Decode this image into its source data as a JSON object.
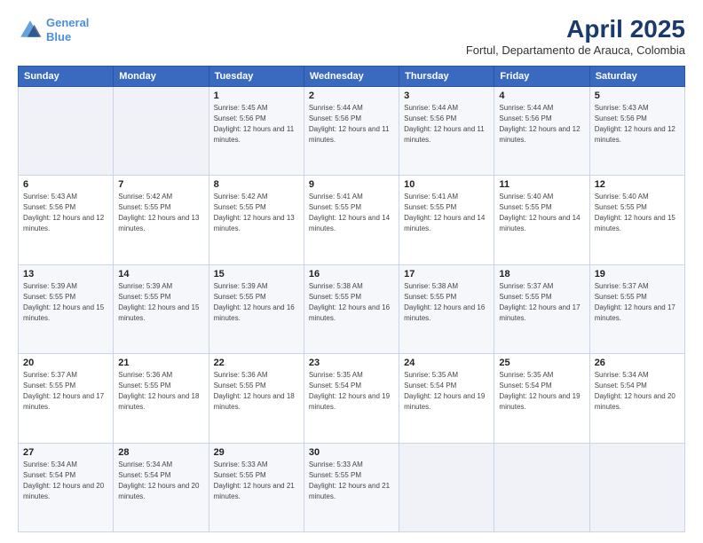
{
  "logo": {
    "line1": "General",
    "line2": "Blue"
  },
  "title": "April 2025",
  "subtitle": "Fortul, Departamento de Arauca, Colombia",
  "header": {
    "days": [
      "Sunday",
      "Monday",
      "Tuesday",
      "Wednesday",
      "Thursday",
      "Friday",
      "Saturday"
    ]
  },
  "weeks": [
    [
      {
        "day": "",
        "sunrise": "",
        "sunset": "",
        "daylight": ""
      },
      {
        "day": "",
        "sunrise": "",
        "sunset": "",
        "daylight": ""
      },
      {
        "day": "1",
        "sunrise": "Sunrise: 5:45 AM",
        "sunset": "Sunset: 5:56 PM",
        "daylight": "Daylight: 12 hours and 11 minutes."
      },
      {
        "day": "2",
        "sunrise": "Sunrise: 5:44 AM",
        "sunset": "Sunset: 5:56 PM",
        "daylight": "Daylight: 12 hours and 11 minutes."
      },
      {
        "day": "3",
        "sunrise": "Sunrise: 5:44 AM",
        "sunset": "Sunset: 5:56 PM",
        "daylight": "Daylight: 12 hours and 11 minutes."
      },
      {
        "day": "4",
        "sunrise": "Sunrise: 5:44 AM",
        "sunset": "Sunset: 5:56 PM",
        "daylight": "Daylight: 12 hours and 12 minutes."
      },
      {
        "day": "5",
        "sunrise": "Sunrise: 5:43 AM",
        "sunset": "Sunset: 5:56 PM",
        "daylight": "Daylight: 12 hours and 12 minutes."
      }
    ],
    [
      {
        "day": "6",
        "sunrise": "Sunrise: 5:43 AM",
        "sunset": "Sunset: 5:56 PM",
        "daylight": "Daylight: 12 hours and 12 minutes."
      },
      {
        "day": "7",
        "sunrise": "Sunrise: 5:42 AM",
        "sunset": "Sunset: 5:55 PM",
        "daylight": "Daylight: 12 hours and 13 minutes."
      },
      {
        "day": "8",
        "sunrise": "Sunrise: 5:42 AM",
        "sunset": "Sunset: 5:55 PM",
        "daylight": "Daylight: 12 hours and 13 minutes."
      },
      {
        "day": "9",
        "sunrise": "Sunrise: 5:41 AM",
        "sunset": "Sunset: 5:55 PM",
        "daylight": "Daylight: 12 hours and 14 minutes."
      },
      {
        "day": "10",
        "sunrise": "Sunrise: 5:41 AM",
        "sunset": "Sunset: 5:55 PM",
        "daylight": "Daylight: 12 hours and 14 minutes."
      },
      {
        "day": "11",
        "sunrise": "Sunrise: 5:40 AM",
        "sunset": "Sunset: 5:55 PM",
        "daylight": "Daylight: 12 hours and 14 minutes."
      },
      {
        "day": "12",
        "sunrise": "Sunrise: 5:40 AM",
        "sunset": "Sunset: 5:55 PM",
        "daylight": "Daylight: 12 hours and 15 minutes."
      }
    ],
    [
      {
        "day": "13",
        "sunrise": "Sunrise: 5:39 AM",
        "sunset": "Sunset: 5:55 PM",
        "daylight": "Daylight: 12 hours and 15 minutes."
      },
      {
        "day": "14",
        "sunrise": "Sunrise: 5:39 AM",
        "sunset": "Sunset: 5:55 PM",
        "daylight": "Daylight: 12 hours and 15 minutes."
      },
      {
        "day": "15",
        "sunrise": "Sunrise: 5:39 AM",
        "sunset": "Sunset: 5:55 PM",
        "daylight": "Daylight: 12 hours and 16 minutes."
      },
      {
        "day": "16",
        "sunrise": "Sunrise: 5:38 AM",
        "sunset": "Sunset: 5:55 PM",
        "daylight": "Daylight: 12 hours and 16 minutes."
      },
      {
        "day": "17",
        "sunrise": "Sunrise: 5:38 AM",
        "sunset": "Sunset: 5:55 PM",
        "daylight": "Daylight: 12 hours and 16 minutes."
      },
      {
        "day": "18",
        "sunrise": "Sunrise: 5:37 AM",
        "sunset": "Sunset: 5:55 PM",
        "daylight": "Daylight: 12 hours and 17 minutes."
      },
      {
        "day": "19",
        "sunrise": "Sunrise: 5:37 AM",
        "sunset": "Sunset: 5:55 PM",
        "daylight": "Daylight: 12 hours and 17 minutes."
      }
    ],
    [
      {
        "day": "20",
        "sunrise": "Sunrise: 5:37 AM",
        "sunset": "Sunset: 5:55 PM",
        "daylight": "Daylight: 12 hours and 17 minutes."
      },
      {
        "day": "21",
        "sunrise": "Sunrise: 5:36 AM",
        "sunset": "Sunset: 5:55 PM",
        "daylight": "Daylight: 12 hours and 18 minutes."
      },
      {
        "day": "22",
        "sunrise": "Sunrise: 5:36 AM",
        "sunset": "Sunset: 5:55 PM",
        "daylight": "Daylight: 12 hours and 18 minutes."
      },
      {
        "day": "23",
        "sunrise": "Sunrise: 5:35 AM",
        "sunset": "Sunset: 5:54 PM",
        "daylight": "Daylight: 12 hours and 19 minutes."
      },
      {
        "day": "24",
        "sunrise": "Sunrise: 5:35 AM",
        "sunset": "Sunset: 5:54 PM",
        "daylight": "Daylight: 12 hours and 19 minutes."
      },
      {
        "day": "25",
        "sunrise": "Sunrise: 5:35 AM",
        "sunset": "Sunset: 5:54 PM",
        "daylight": "Daylight: 12 hours and 19 minutes."
      },
      {
        "day": "26",
        "sunrise": "Sunrise: 5:34 AM",
        "sunset": "Sunset: 5:54 PM",
        "daylight": "Daylight: 12 hours and 20 minutes."
      }
    ],
    [
      {
        "day": "27",
        "sunrise": "Sunrise: 5:34 AM",
        "sunset": "Sunset: 5:54 PM",
        "daylight": "Daylight: 12 hours and 20 minutes."
      },
      {
        "day": "28",
        "sunrise": "Sunrise: 5:34 AM",
        "sunset": "Sunset: 5:54 PM",
        "daylight": "Daylight: 12 hours and 20 minutes."
      },
      {
        "day": "29",
        "sunrise": "Sunrise: 5:33 AM",
        "sunset": "Sunset: 5:55 PM",
        "daylight": "Daylight: 12 hours and 21 minutes."
      },
      {
        "day": "30",
        "sunrise": "Sunrise: 5:33 AM",
        "sunset": "Sunset: 5:55 PM",
        "daylight": "Daylight: 12 hours and 21 minutes."
      },
      {
        "day": "",
        "sunrise": "",
        "sunset": "",
        "daylight": ""
      },
      {
        "day": "",
        "sunrise": "",
        "sunset": "",
        "daylight": ""
      },
      {
        "day": "",
        "sunrise": "",
        "sunset": "",
        "daylight": ""
      }
    ]
  ]
}
